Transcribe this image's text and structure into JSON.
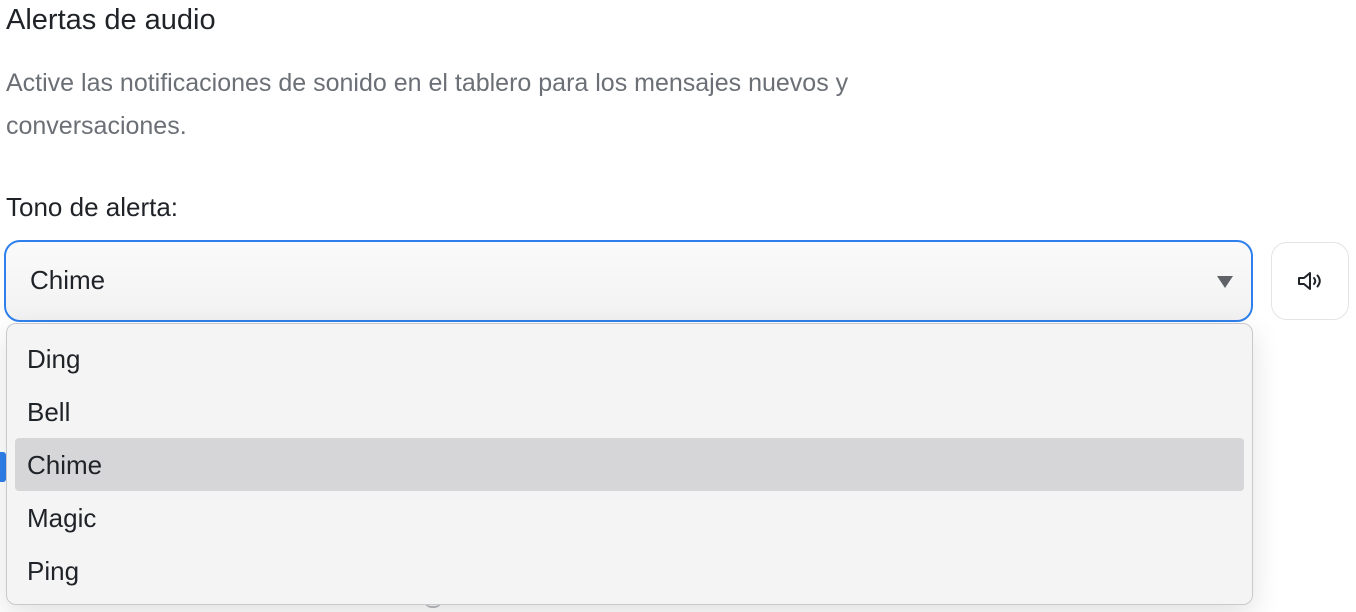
{
  "section": {
    "title": "Alertas de audio",
    "description": "Active las notificaciones de sonido en el tablero para los mensajes nuevos y conversaciones."
  },
  "tone_field": {
    "label": "Tono de alerta:",
    "selected_value": "Chime",
    "options": [
      {
        "label": "Ding",
        "selected": false
      },
      {
        "label": "Bell",
        "selected": false
      },
      {
        "label": "Chime",
        "selected": true
      },
      {
        "label": "Magic",
        "selected": false
      },
      {
        "label": "Ping",
        "selected": false
      }
    ]
  },
  "play_button": {
    "icon": "speaker-icon"
  },
  "colors": {
    "focus_border": "#2f80ed",
    "selected_option_bg": "#d6d6d8",
    "muted_text": "#6b6f76"
  }
}
